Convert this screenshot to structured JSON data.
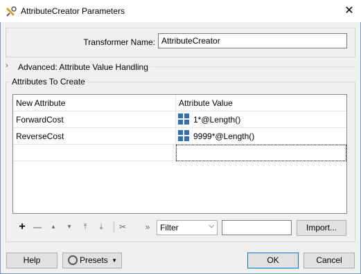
{
  "window": {
    "title": "AttributeCreator Parameters",
    "close_symbol": "✕"
  },
  "transformer": {
    "label": "Transformer Name:",
    "value": "AttributeCreator"
  },
  "advanced": {
    "chevron": "›",
    "label": "Advanced: Attribute Value Handling"
  },
  "attributes": {
    "group_label": "Attributes To Create",
    "headers": [
      "New Attribute",
      "Attribute Value"
    ],
    "rows": [
      {
        "name": "ForwardCost",
        "value": "1*@Length()"
      },
      {
        "name": "ReverseCost",
        "value": "9999*@Length()"
      }
    ]
  },
  "toolbar": {
    "add": "+",
    "remove": "—",
    "move_up": "▲",
    "move_down": "▼",
    "move_top": "⤒",
    "move_bottom": "⤓",
    "cut": "✂",
    "more": "»",
    "filter_selected": "Filter",
    "filter_arrow": "⌵",
    "import_label": "Import..."
  },
  "footer": {
    "help": "Help",
    "presets": "Presets",
    "ok": "OK",
    "cancel": "Cancel"
  }
}
